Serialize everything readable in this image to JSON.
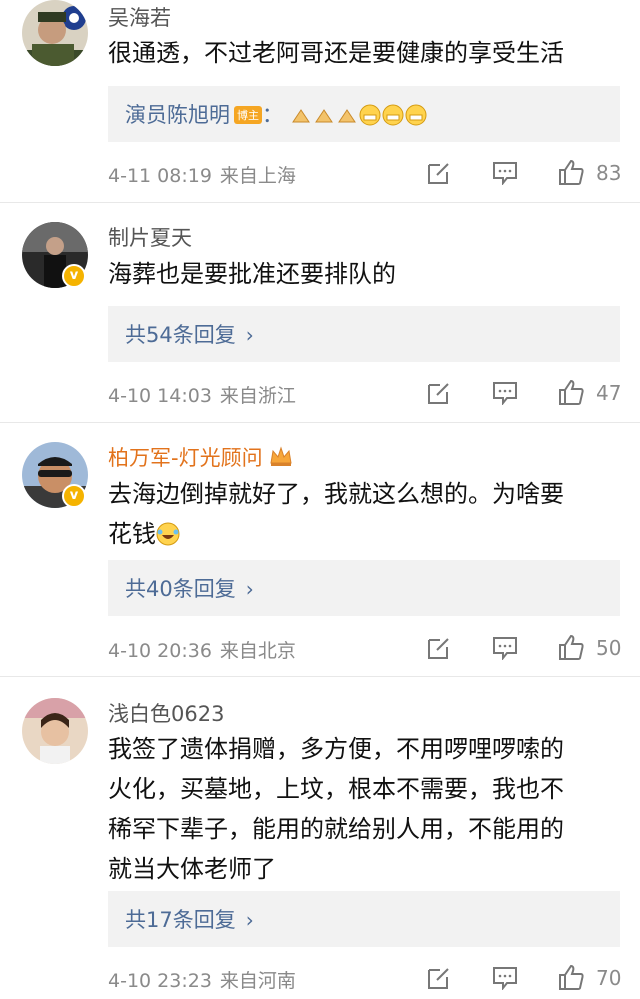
{
  "comments": [
    {
      "user": "吴海若",
      "text": "很通透，不过老阿哥还是要健康的享受生活",
      "reply_author": "演员陈旭明",
      "reply_tag": "博主",
      "reply_colon": "：",
      "time": "4-11 08:19",
      "location": "来自上海",
      "likes": "83",
      "emojis": [
        "pray-emoji",
        "pray-emoji",
        "pray-emoji",
        "grin-emoji",
        "grin-emoji",
        "grin-emoji"
      ]
    },
    {
      "user": "制片夏天",
      "text": "海葬也是要批准还要排队的",
      "replies": "共54条回复",
      "time": "4-10 14:03",
      "location": "来自浙江",
      "likes": "47"
    },
    {
      "user": "柏万军-灯光顾问",
      "text_line1": "去海边倒掉就好了，我就这么想的。为啥要",
      "text_line2": "花钱",
      "replies": "共40条回复",
      "time": "4-10 20:36",
      "location": "来自北京",
      "likes": "50"
    },
    {
      "user": "浅白色0623",
      "text_lines": [
        "我签了遗体捐赠，多方便，不用啰哩啰嗦的",
        "火化，买墓地，上坟，根本不需要，我也不",
        "稀罕下辈子，能用的就给别人用，不能用的",
        "就当大体老师了"
      ],
      "replies": "共17条回复",
      "time": "4-10 23:23",
      "location": "来自河南",
      "likes": "70"
    }
  ],
  "icons": {
    "chevron": "›",
    "edit": "edit-icon",
    "comment": "comment-icon",
    "like": "thumbs-up-icon"
  },
  "colors": {
    "link": "#4d6b96",
    "gold_name": "#e2731c",
    "meta": "#8a8a8a",
    "reply_bg": "#f2f2f2"
  }
}
